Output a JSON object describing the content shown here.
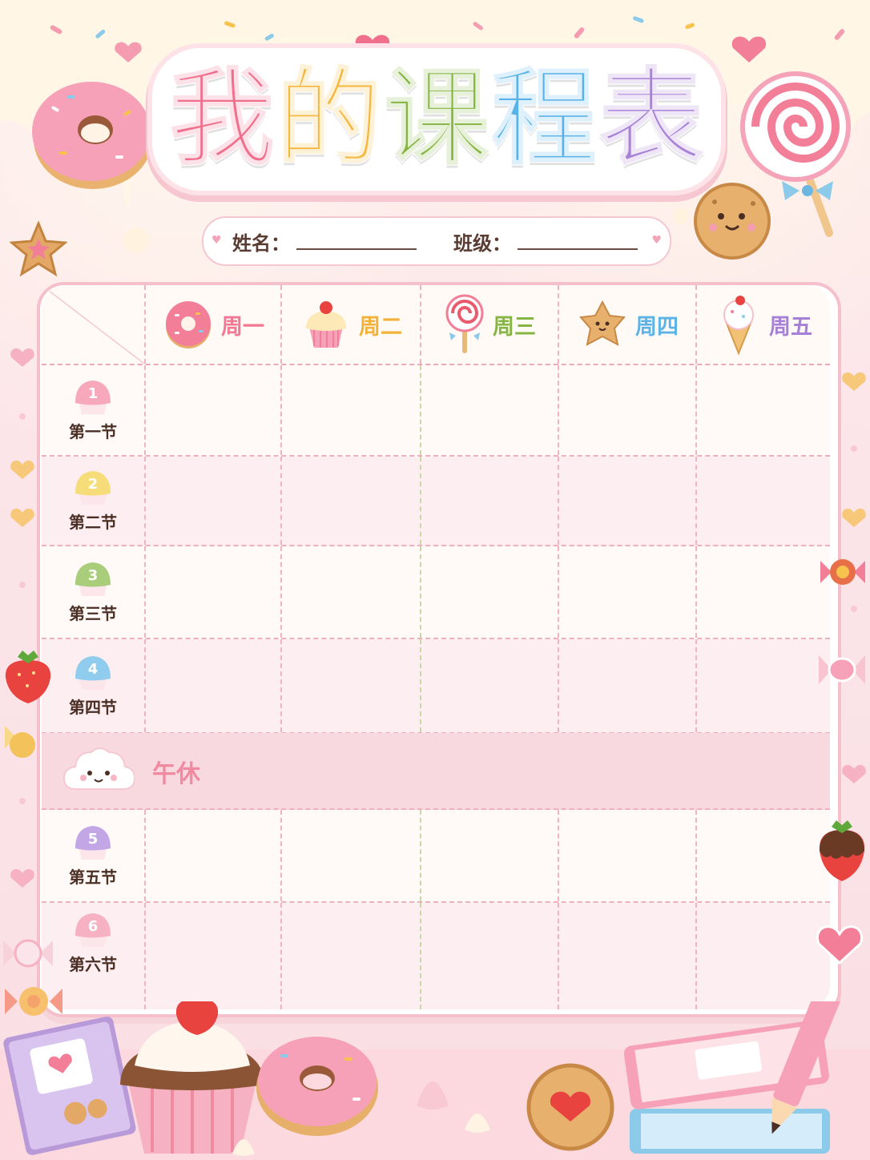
{
  "title": {
    "chars": [
      "我",
      "的",
      "课",
      "程",
      "表"
    ],
    "colors": [
      "#f06f8c",
      "#f5b73d",
      "#86b443",
      "#58b2e8",
      "#a982d6"
    ]
  },
  "info": {
    "name_label": "姓名：",
    "class_label": "班级："
  },
  "days": [
    {
      "label": "周一",
      "color": "#f07893",
      "icon": "donut-icon"
    },
    {
      "label": "周二",
      "color": "#f2b23a",
      "icon": "cupcake-icon"
    },
    {
      "label": "周三",
      "color": "#85b542",
      "icon": "lollipop-icon"
    },
    {
      "label": "周四",
      "color": "#5bb3e6",
      "icon": "cookie-icon"
    },
    {
      "label": "周五",
      "color": "#a67fd6",
      "icon": "ice-cream-icon"
    }
  ],
  "periods": [
    {
      "num": "1",
      "label": "第一节",
      "color": "#f7a8bb"
    },
    {
      "num": "2",
      "label": "第二节",
      "color": "#f7dc7a"
    },
    {
      "num": "3",
      "label": "第三节",
      "color": "#a9cd7a"
    },
    {
      "num": "4",
      "label": "第四节",
      "color": "#8fccee"
    },
    {
      "num": "5",
      "label": "第五节",
      "color": "#c3a6e6"
    },
    {
      "num": "6",
      "label": "第六节",
      "color": "#f6b2c2"
    }
  ],
  "lunch_label": "午休"
}
